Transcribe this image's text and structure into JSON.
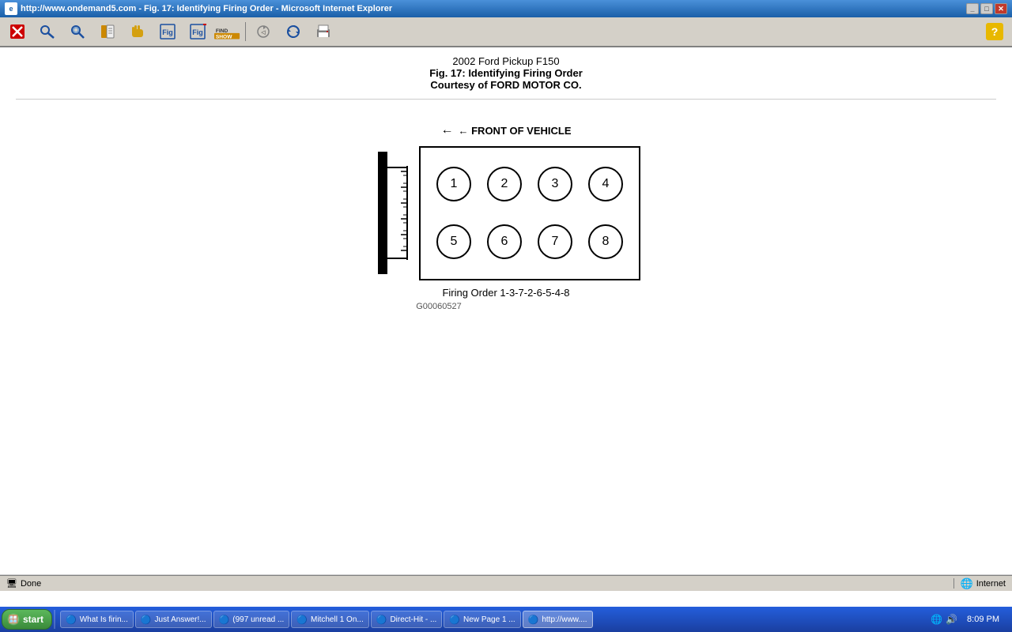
{
  "window": {
    "title": "http://www.ondemand5.com - Fig. 17: Identifying Firing Order - Microsoft Internet Explorer",
    "title_icon": "IE"
  },
  "toolbar": {
    "close_label": "✕",
    "buttons": [
      "close",
      "key",
      "search",
      "book",
      "hand",
      "fig",
      "fig2",
      "search2",
      "refresh",
      "print"
    ]
  },
  "help": {
    "label": "?"
  },
  "page": {
    "title": "2002 Ford Pickup F150",
    "subtitle": "Fig. 17: Identifying Firing Order",
    "source": "Courtesy of FORD MOTOR CO."
  },
  "diagram": {
    "front_label": "← FRONT OF VEHICLE",
    "cylinders_top": [
      "①",
      "②",
      "③",
      "④"
    ],
    "cylinders_bottom": [
      "⑤",
      "⑥",
      "⑦",
      "⑧"
    ],
    "firing_order_label": "Firing Order 1-3-7-2-6-5-4-8",
    "diagram_code": "G00060527"
  },
  "status": {
    "done": "Done",
    "internet": "Internet"
  },
  "taskbar": {
    "start_label": "start",
    "time": "8:09 PM",
    "items": [
      {
        "label": "What Is firin...",
        "icon": "🔵"
      },
      {
        "label": "Just Answer!...",
        "icon": "🔵"
      },
      {
        "label": "(997 unread ...",
        "icon": "🔵"
      },
      {
        "label": "Mitchell 1 On...",
        "icon": "🔵"
      },
      {
        "label": "Direct-Hit - ...",
        "icon": "🔵"
      },
      {
        "label": "New Page 1 ...",
        "icon": "🔵"
      },
      {
        "label": "http://www....",
        "icon": "🔵",
        "active": true
      }
    ]
  }
}
